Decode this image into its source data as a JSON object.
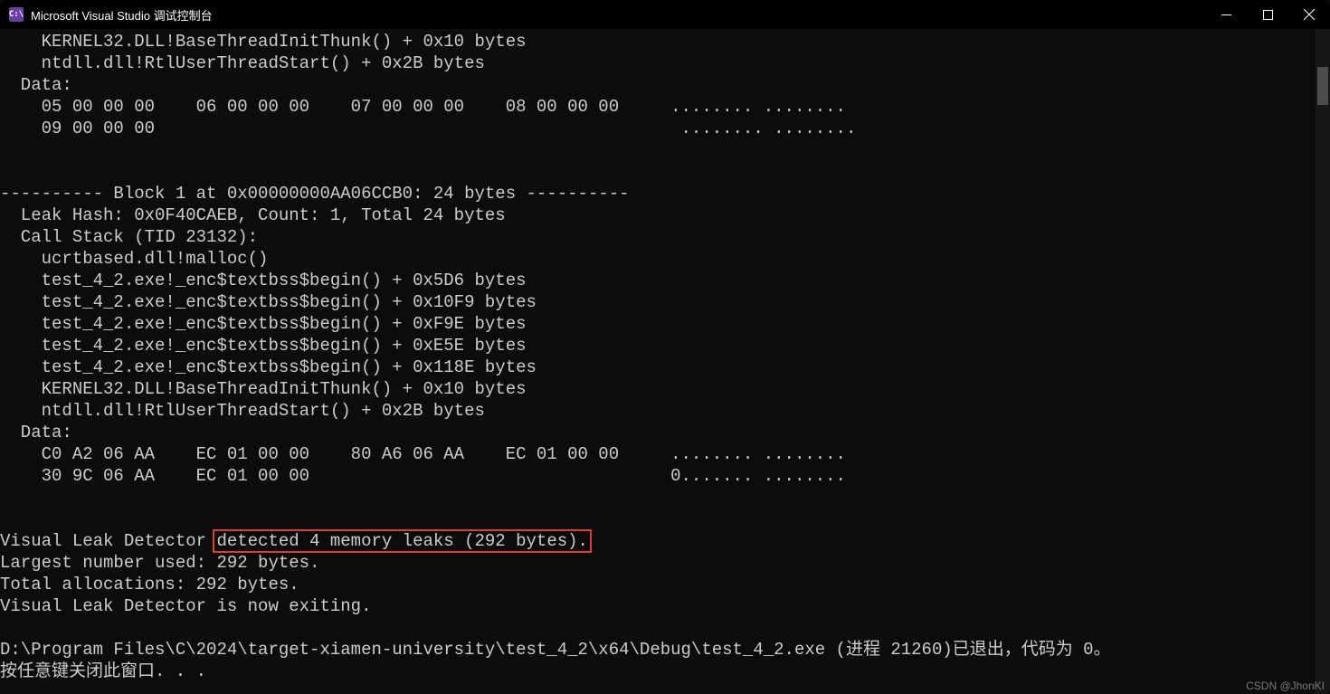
{
  "titlebar": {
    "icon_label": "C:\\",
    "title": "Microsoft Visual Studio 调试控制台"
  },
  "console": {
    "lines": [
      "    KERNEL32.DLL!BaseThreadInitThunk() + 0x10 bytes",
      "    ntdll.dll!RtlUserThreadStart() + 0x2B bytes",
      "  Data:",
      "    05 00 00 00    06 00 00 00    07 00 00 00    08 00 00 00     ........ ........",
      "    09 00 00 00                                                   ........ ........",
      "",
      "",
      "---------- Block 1 at 0x00000000AA06CCB0: 24 bytes ----------",
      "  Leak Hash: 0x0F40CAEB, Count: 1, Total 24 bytes",
      "  Call Stack (TID 23132):",
      "    ucrtbased.dll!malloc()",
      "    test_4_2.exe!_enc$textbss$begin() + 0x5D6 bytes",
      "    test_4_2.exe!_enc$textbss$begin() + 0x10F9 bytes",
      "    test_4_2.exe!_enc$textbss$begin() + 0xF9E bytes",
      "    test_4_2.exe!_enc$textbss$begin() + 0xE5E bytes",
      "    test_4_2.exe!_enc$textbss$begin() + 0x118E bytes",
      "    KERNEL32.DLL!BaseThreadInitThunk() + 0x10 bytes",
      "    ntdll.dll!RtlUserThreadStart() + 0x2B bytes",
      "  Data:",
      "    C0 A2 06 AA    EC 01 00 00    80 A6 06 AA    EC 01 00 00     ........ ........",
      "    30 9C 06 AA    EC 01 00 00                                   0....... ........",
      "",
      "",
      "Visual Leak Detector detected 4 memory leaks (292 bytes).",
      "Largest number used: 292 bytes.",
      "Total allocations: 292 bytes.",
      "Visual Leak Detector is now exiting.",
      "",
      "D:\\Program Files\\C\\2024\\target-xiamen-university\\test_4_2\\x64\\Debug\\test_4_2.exe (进程 21260)已退出，代码为 0。",
      "按任意键关闭此窗口. . ."
    ],
    "highlight_line_index": 23,
    "highlight_prefix": "Visual Leak Detector ",
    "highlight_text": "detected 4 memory leaks (292 bytes)."
  },
  "watermark": "CSDN @JhonKI"
}
